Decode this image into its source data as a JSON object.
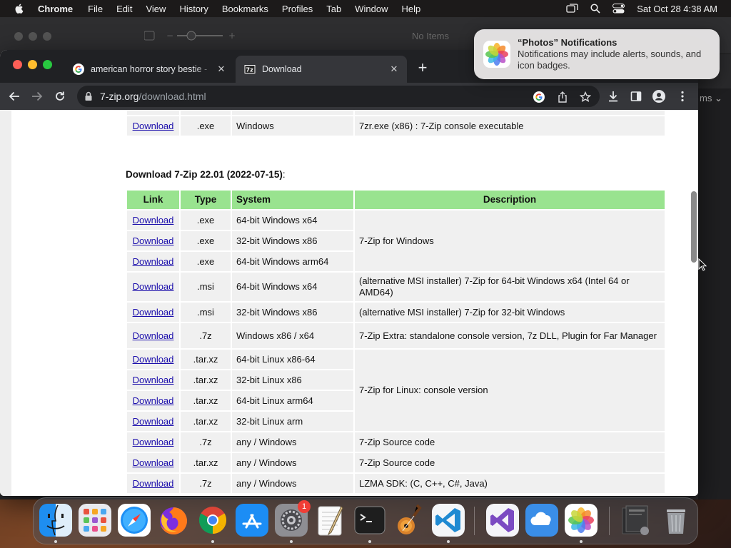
{
  "menubar": {
    "app_name": "Chrome",
    "items": [
      "File",
      "Edit",
      "View",
      "History",
      "Bookmarks",
      "Profiles",
      "Tab",
      "Window",
      "Help"
    ],
    "clock": "Sat Oct 28  4:38 AM"
  },
  "background_window": {
    "no_items": "No Items",
    "side_label": "ms"
  },
  "browser": {
    "tabs": [
      {
        "title": "american horror story bestie -",
        "icon": "google-favicon",
        "active": false
      },
      {
        "title": "Download",
        "icon": "7zip-favicon",
        "active": true
      }
    ],
    "url_host": "7-zip.org",
    "url_path": "/download.html"
  },
  "page": {
    "top_row": {
      "link": "Download",
      "type": ".exe",
      "system": "Windows",
      "description": "7zr.exe (x86) : 7-Zip console executable"
    },
    "section_title": "Download 7-Zip 22.01 (2022-07-15)",
    "section_colon": ":",
    "headers": {
      "link": "Link",
      "type": "Type",
      "system": "System",
      "description": "Description"
    },
    "rows": [
      {
        "link": "Download",
        "type": ".exe",
        "system": "64-bit Windows x64"
      },
      {
        "link": "Download",
        "type": ".exe",
        "system": "32-bit Windows x86"
      },
      {
        "link": "Download",
        "type": ".exe",
        "system": "64-bit Windows arm64"
      },
      {
        "link": "Download",
        "type": ".msi",
        "system": "64-bit Windows x64"
      },
      {
        "link": "Download",
        "type": ".msi",
        "system": "32-bit Windows x86"
      },
      {
        "link": "Download",
        "type": ".7z",
        "system": "Windows x86 / x64"
      },
      {
        "link": "Download",
        "type": ".tar.xz",
        "system": "64-bit Linux x86-64"
      },
      {
        "link": "Download",
        "type": ".tar.xz",
        "system": "32-bit Linux x86"
      },
      {
        "link": "Download",
        "type": ".tar.xz",
        "system": "64-bit Linux arm64"
      },
      {
        "link": "Download",
        "type": ".tar.xz",
        "system": "32-bit Linux arm"
      },
      {
        "link": "Download",
        "type": ".7z",
        "system": "any / Windows"
      },
      {
        "link": "Download",
        "type": ".tar.xz",
        "system": "any / Windows"
      },
      {
        "link": "Download",
        "type": ".7z",
        "system": "any / Windows"
      }
    ],
    "descriptions": {
      "windows": "7-Zip for Windows",
      "msi64": "(alternative MSI installer) 7-Zip for 64-bit Windows x64 (Intel 64 or AMD64)",
      "msi32": "(alternative MSI installer) 7-Zip for 32-bit Windows",
      "extra": "7-Zip Extra: standalone console version, 7z DLL, Plugin for Far Manager",
      "linux": "7-Zip for Linux: console version",
      "source1": "7-Zip Source code",
      "source2": "7-Zip Source code",
      "lzma": "LZMA SDK: (C, C++, C#, Java)"
    }
  },
  "notification": {
    "title": "“Photos” Notifications",
    "body": "Notifications may include alerts, sounds, and icon badges."
  },
  "dock": {
    "items": [
      "finder-icon",
      "launchpad-icon",
      "safari-icon",
      "firefox-icon",
      "chrome-icon",
      "app-store-icon",
      "system-settings-icon",
      "textedit-icon",
      "terminal-icon",
      "garageband-icon",
      "vscode-icon",
      "visual-studio-icon",
      "icloud-icon",
      "photos-icon",
      "downloads-stack-icon",
      "trash-icon"
    ],
    "settings_badge": "1"
  },
  "colors": {
    "table_header": "#99e38f",
    "table_cell": "#f0f0f0",
    "link": "#1a0dab"
  }
}
